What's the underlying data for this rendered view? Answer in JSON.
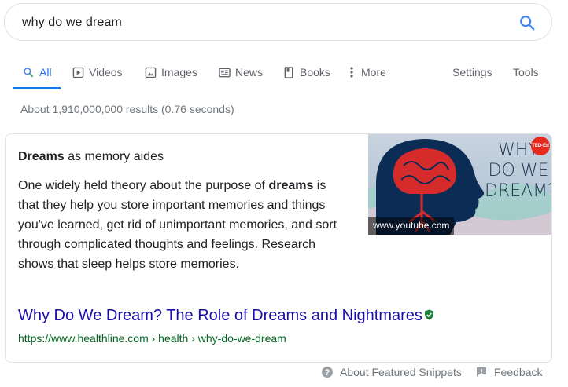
{
  "search": {
    "query": "why do we dream"
  },
  "tabs": [
    {
      "label": "All",
      "icon": "search-icon",
      "active": true
    },
    {
      "label": "Videos",
      "icon": "video-icon"
    },
    {
      "label": "Images",
      "icon": "image-icon"
    },
    {
      "label": "News",
      "icon": "news-icon"
    },
    {
      "label": "Books",
      "icon": "book-icon"
    },
    {
      "label": "More",
      "icon": "more-vert-icon"
    }
  ],
  "tools": {
    "settings_label": "Settings",
    "tools_label": "Tools"
  },
  "results_stats": "About 1,910,000,000 results (0.76 seconds)",
  "featured_snippet": {
    "heading_bold": "Dreams",
    "heading_rest": " as memory aides",
    "body_part1": "One widely held theory about the purpose of ",
    "body_bold": "dreams",
    "body_part2": " is that they help you store important memories and things you've learned, get rid of unimportant memories, and sort through complicated thoughts and feelings. Research shows that sleep helps store memories.",
    "thumbnail_source": "www.youtube.com",
    "thumbnail_text_lines": [
      "WHY",
      "DO WE",
      "DREAM?"
    ],
    "thumbnail_badge": "TED-Ed",
    "title": "Why Do We Dream? The Role of Dreams and Nightmares",
    "url": "https://www.healthline.com › health › why-do-we-dream"
  },
  "footer": {
    "about_label": "About Featured Snippets",
    "feedback_label": "Feedback"
  },
  "colors": {
    "accent": "#1a73e8",
    "link": "#1a0dab",
    "url_green": "#006621",
    "verified_green": "#188038"
  }
}
